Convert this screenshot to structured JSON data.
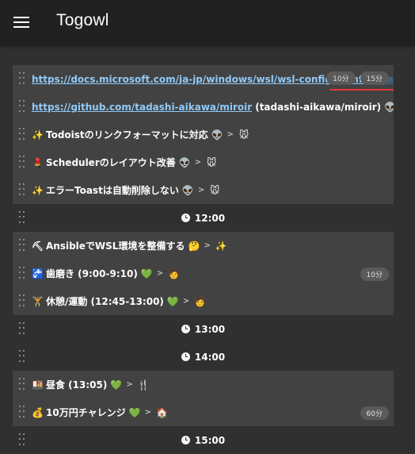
{
  "app": {
    "title": "Togowl",
    "menu_icon": "hamburger-menu-icon"
  },
  "rows": [
    {
      "kind": "task",
      "link": "https://docs.microsoft.com/ja-jp/windows/wsl/wsl-config#config",
      "trail": "urations-for-wsl",
      "badges": [
        "10分",
        "15分"
      ]
    },
    {
      "kind": "task",
      "link": "https://github.com/tadashi-aikawa/miroir",
      "text": "(tadashi-aikawa/miroir)",
      "e1": "👽",
      "e2": "🐿"
    },
    {
      "kind": "task",
      "lead": "✨",
      "text": "Todoistのリンクフォーマットに対応",
      "e1": "👽",
      "e2": "🐭"
    },
    {
      "kind": "task",
      "lead": "💄",
      "text": "Schedulerのレイアウト改善",
      "e1": "👽",
      "e2": "🐭"
    },
    {
      "kind": "task",
      "lead": "✨",
      "text": "エラーToastは自動削除しない",
      "e1": "👽",
      "e2": "🐭"
    },
    {
      "kind": "time",
      "time": "12:00"
    },
    {
      "kind": "task",
      "lead": "⛏",
      "text": "AnsibleでWSL環境を整備する",
      "e1": "🤔",
      "e2": "✨"
    },
    {
      "kind": "task",
      "lead": "🚰",
      "text": "歯磨き (9:00-9:10)",
      "e1": "💚",
      "e2": "🧑",
      "badge": "10分"
    },
    {
      "kind": "task",
      "lead": "🏋",
      "text": "休憩/運動 (12:45-13:00)",
      "e1": "💚",
      "e2": "🧑"
    },
    {
      "kind": "time",
      "time": "13:00"
    },
    {
      "kind": "time",
      "time": "14:00"
    },
    {
      "kind": "task",
      "lead": "🍱",
      "text": "昼食 (13:05)",
      "e1": "💚",
      "e2": "🍴"
    },
    {
      "kind": "task",
      "lead": "💰",
      "text": "10万円チャレンジ",
      "e1": "💚",
      "e2": "🏠",
      "badge": "60分"
    },
    {
      "kind": "time",
      "time": "15:00"
    }
  ],
  "separator": ">",
  "colors": {
    "link": "#90caf9",
    "task_bg": "#424242",
    "appbar": "#212121",
    "highlight": "#e53935"
  }
}
